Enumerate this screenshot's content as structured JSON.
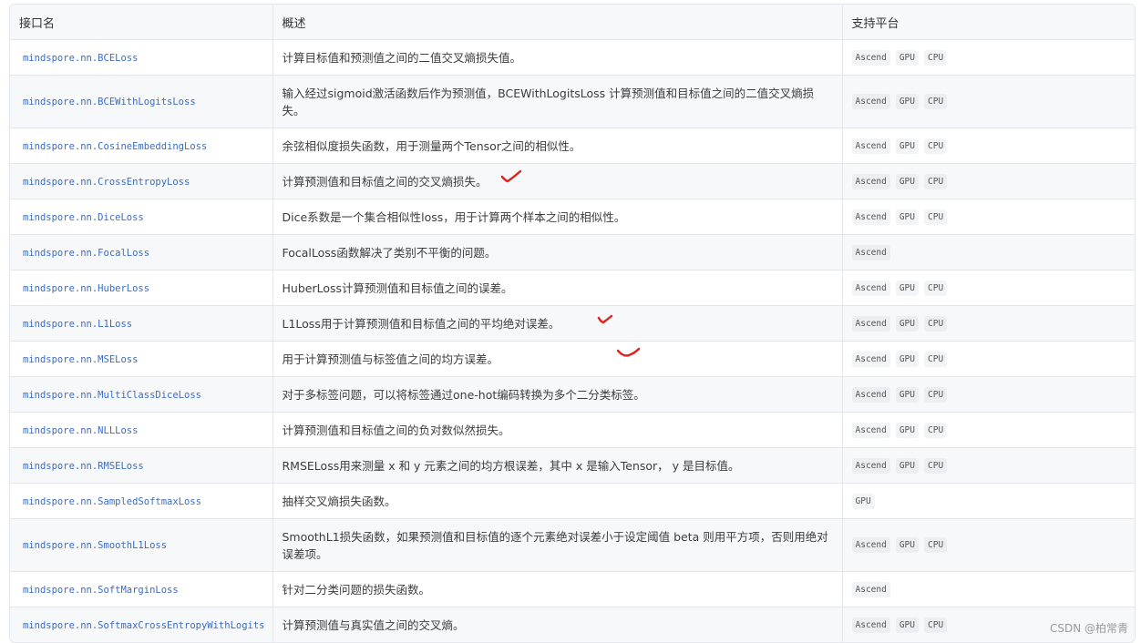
{
  "header": {
    "col1": "接口名",
    "col2": "概述",
    "col3": "支持平台"
  },
  "rows": [
    {
      "name": "mindspore.nn.BCELoss",
      "desc": "计算目标值和预测值之间的二值交叉熵损失值。",
      "platforms": [
        "Ascend",
        "GPU",
        "CPU"
      ]
    },
    {
      "name": "mindspore.nn.BCEWithLogitsLoss",
      "desc": "输入经过sigmoid激活函数后作为预测值，BCEWithLogitsLoss 计算预测值和目标值之间的二值交叉熵损失。",
      "platforms": [
        "Ascend",
        "GPU",
        "CPU"
      ]
    },
    {
      "name": "mindspore.nn.CosineEmbeddingLoss",
      "desc": "余弦相似度损失函数，用于测量两个Tensor之间的相似性。",
      "platforms": [
        "Ascend",
        "GPU",
        "CPU"
      ]
    },
    {
      "name": "mindspore.nn.CrossEntropyLoss",
      "desc": "计算预测值和目标值之间的交叉熵损失。",
      "platforms": [
        "Ascend",
        "GPU",
        "CPU"
      ]
    },
    {
      "name": "mindspore.nn.DiceLoss",
      "desc": "Dice系数是一个集合相似性loss，用于计算两个样本之间的相似性。",
      "platforms": [
        "Ascend",
        "GPU",
        "CPU"
      ]
    },
    {
      "name": "mindspore.nn.FocalLoss",
      "desc": "FocalLoss函数解决了类别不平衡的问题。",
      "platforms": [
        "Ascend"
      ]
    },
    {
      "name": "mindspore.nn.HuberLoss",
      "desc": "HuberLoss计算预测值和目标值之间的误差。",
      "platforms": [
        "Ascend",
        "GPU",
        "CPU"
      ]
    },
    {
      "name": "mindspore.nn.L1Loss",
      "desc": "L1Loss用于计算预测值和目标值之间的平均绝对误差。",
      "platforms": [
        "Ascend",
        "GPU",
        "CPU"
      ]
    },
    {
      "name": "mindspore.nn.MSELoss",
      "desc": "用于计算预测值与标签值之间的均方误差。",
      "platforms": [
        "Ascend",
        "GPU",
        "CPU"
      ]
    },
    {
      "name": "mindspore.nn.MultiClassDiceLoss",
      "desc": "对于多标签问题，可以将标签通过one-hot编码转换为多个二分类标签。",
      "platforms": [
        "Ascend",
        "GPU",
        "CPU"
      ]
    },
    {
      "name": "mindspore.nn.NLLLoss",
      "desc": "计算预测值和目标值之间的负对数似然损失。",
      "platforms": [
        "Ascend",
        "GPU",
        "CPU"
      ]
    },
    {
      "name": "mindspore.nn.RMSELoss",
      "desc": "RMSELoss用来测量 x 和 y 元素之间的均方根误差，其中 x 是输入Tensor， y 是目标值。",
      "platforms": [
        "Ascend",
        "GPU",
        "CPU"
      ]
    },
    {
      "name": "mindspore.nn.SampledSoftmaxLoss",
      "desc": "抽样交叉熵损失函数。",
      "platforms": [
        "GPU"
      ]
    },
    {
      "name": "mindspore.nn.SmoothL1Loss",
      "desc": "SmoothL1损失函数，如果预测值和目标值的逐个元素绝对误差小于设定阈值 beta 则用平方项，否则用绝对误差项。",
      "platforms": [
        "Ascend",
        "GPU",
        "CPU"
      ]
    },
    {
      "name": "mindspore.nn.SoftMarginLoss",
      "desc": "针对二分类问题的损失函数。",
      "platforms": [
        "Ascend"
      ]
    },
    {
      "name": "mindspore.nn.SoftmaxCrossEntropyWithLogits",
      "desc": "计算预测值与真实值之间的交叉熵。",
      "platforms": [
        "Ascend",
        "GPU",
        "CPU"
      ]
    }
  ],
  "watermark": "CSDN @柏常青",
  "colors": {
    "link": "#3b6cc2",
    "check_mark": "#e0201b"
  }
}
